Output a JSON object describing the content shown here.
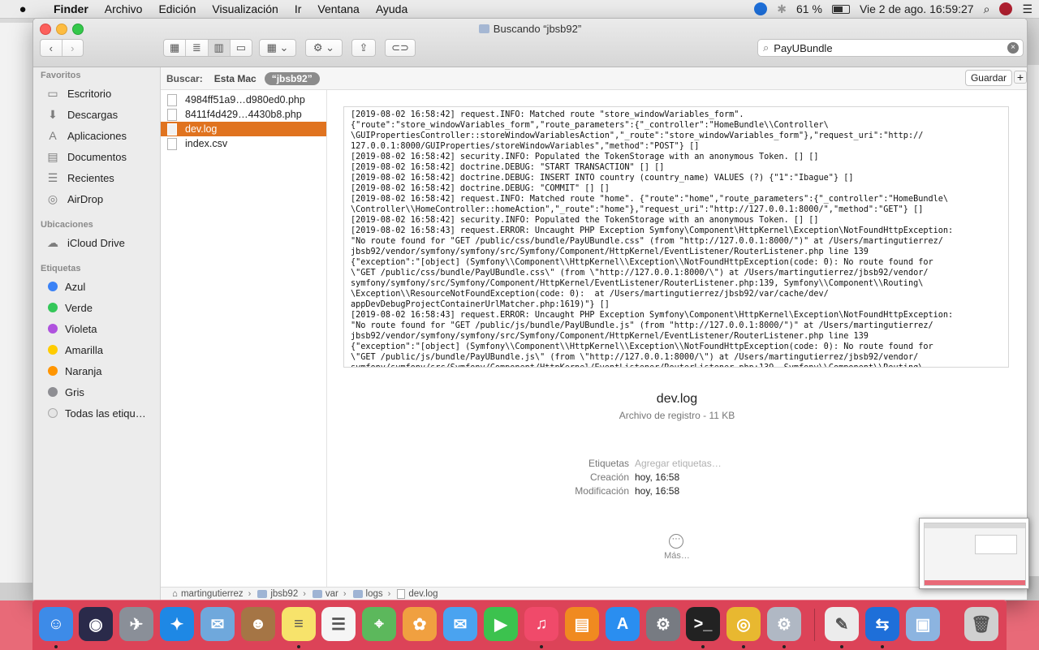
{
  "menubar": {
    "app": "Finder",
    "items": [
      "Archivo",
      "Edición",
      "Visualización",
      "Ir",
      "Ventana",
      "Ayuda"
    ],
    "battery": "61 %",
    "datetime": "Vie 2 de ago.  16:59:27"
  },
  "window": {
    "title": "Buscando “jbsb92”"
  },
  "search": {
    "value": "PayUBundle"
  },
  "scope": {
    "label": "Buscar:",
    "this_mac": "Esta Mac",
    "folder": "“jbsb92”",
    "save": "Guardar",
    "add": "+"
  },
  "sidebar": {
    "favorites_header": "Favoritos",
    "favorites": [
      {
        "label": "Escritorio",
        "icon": "desktop-icon"
      },
      {
        "label": "Descargas",
        "icon": "downloads-icon"
      },
      {
        "label": "Aplicaciones",
        "icon": "applications-icon"
      },
      {
        "label": "Documentos",
        "icon": "documents-icon"
      },
      {
        "label": "Recientes",
        "icon": "recents-icon"
      },
      {
        "label": "AirDrop",
        "icon": "airdrop-icon"
      }
    ],
    "locations_header": "Ubicaciones",
    "locations": [
      {
        "label": "iCloud Drive",
        "icon": "cloud-icon"
      }
    ],
    "tags_header": "Etiquetas",
    "tags": [
      {
        "label": "Azul",
        "color": "#3b82f6"
      },
      {
        "label": "Verde",
        "color": "#34c759"
      },
      {
        "label": "Violeta",
        "color": "#af52de"
      },
      {
        "label": "Amarilla",
        "color": "#ffcc00"
      },
      {
        "label": "Naranja",
        "color": "#ff9500"
      },
      {
        "label": "Gris",
        "color": "#8e8e93"
      },
      {
        "label": "Todas las etiqu…",
        "color": "#e5e5e5"
      }
    ]
  },
  "files": [
    {
      "name": "4984ff51a9…d980ed0.php",
      "selected": false
    },
    {
      "name": "8411f4d429…4430b8.php",
      "selected": false
    },
    {
      "name": "dev.log",
      "selected": true
    },
    {
      "name": "index.csv",
      "selected": false
    }
  ],
  "preview": {
    "log": "[2019-08-02 16:58:42] request.INFO: Matched route \"store_windowVariables_form\".\n{\"route\":\"store_windowVariables_form\",\"route_parameters\":{\"_controller\":\"HomeBundle\\\\Controller\\\n\\GUIPropertiesController::storeWindowVariablesAction\",\"_route\":\"store_windowVariables_form\"},\"request_uri\":\"http://\n127.0.0.1:8000/GUIProperties/storeWindowVariables\",\"method\":\"POST\"} []\n[2019-08-02 16:58:42] security.INFO: Populated the TokenStorage with an anonymous Token. [] []\n[2019-08-02 16:58:42] doctrine.DEBUG: \"START TRANSACTION\" [] []\n[2019-08-02 16:58:42] doctrine.DEBUG: INSERT INTO country (country_name) VALUES (?) {\"1\":\"Ibague\"} []\n[2019-08-02 16:58:42] doctrine.DEBUG: \"COMMIT\" [] []\n[2019-08-02 16:58:42] request.INFO: Matched route \"home\". {\"route\":\"home\",\"route_parameters\":{\"_controller\":\"HomeBundle\\\n\\Controller\\\\HomeController::homeAction\",\"_route\":\"home\"},\"request_uri\":\"http://127.0.0.1:8000/\",\"method\":\"GET\"} []\n[2019-08-02 16:58:42] security.INFO: Populated the TokenStorage with an anonymous Token. [] []\n[2019-08-02 16:58:43] request.ERROR: Uncaught PHP Exception Symfony\\Component\\HttpKernel\\Exception\\NotFoundHttpException:\n\"No route found for \"GET /public/css/bundle/PayUBundle.css\" (from \"http://127.0.0.1:8000/\")\" at /Users/martingutierrez/\njbsb92/vendor/symfony/symfony/src/Symfony/Component/HttpKernel/EventListener/RouterListener.php line 139\n{\"exception\":\"[object] (Symfony\\\\Component\\\\HttpKernel\\\\Exception\\\\NotFoundHttpException(code: 0): No route found for\n\\\"GET /public/css/bundle/PayUBundle.css\\\" (from \\\"http://127.0.0.1:8000/\\\") at /Users/martingutierrez/jbsb92/vendor/\nsymfony/symfony/src/Symfony/Component/HttpKernel/EventListener/RouterListener.php:139, Symfony\\\\Component\\\\Routing\\\n\\Exception\\\\ResourceNotFoundException(code: 0):  at /Users/martingutierrez/jbsb92/var/cache/dev/\nappDevDebugProjectContainerUrlMatcher.php:1619)\"} []\n[2019-08-02 16:58:43] request.ERROR: Uncaught PHP Exception Symfony\\Component\\HttpKernel\\Exception\\NotFoundHttpException:\n\"No route found for \"GET /public/js/bundle/PayUBundle.js\" (from \"http://127.0.0.1:8000/\")\" at /Users/martingutierrez/\njbsb92/vendor/symfony/symfony/src/Symfony/Component/HttpKernel/EventListener/RouterListener.php line 139\n{\"exception\":\"[object] (Symfony\\\\Component\\\\HttpKernel\\\\Exception\\\\NotFoundHttpException(code: 0): No route found for\n\\\"GET /public/js/bundle/PayUBundle.js\\\" (from \\\"http://127.0.0.1:8000/\\\") at /Users/martingutierrez/jbsb92/vendor/\nsymfony/symfony/src/Symfony/Component/HttpKernel/EventListener/RouterListener.php:139, Symfony\\\\Component\\\\Routing\\",
    "name": "dev.log",
    "kind": "Archivo de registro - 11 KB",
    "tags_label": "Etiquetas",
    "tags_placeholder": "Agregar etiquetas…",
    "created_label": "Creación",
    "created_value": "hoy, 16:58",
    "modified_label": "Modificación",
    "modified_value": "hoy, 16:58",
    "more_label": "Más…"
  },
  "pathbar": [
    "martingutierrez",
    "jbsb92",
    "var",
    "logs",
    "dev.log"
  ],
  "dock": [
    {
      "name": "finder-icon",
      "color": "#3d8be8",
      "glyph": "☺",
      "running": true
    },
    {
      "name": "siri-icon",
      "color": "#2a2a4a",
      "glyph": "◉",
      "running": false
    },
    {
      "name": "launchpad-icon",
      "color": "#8a8f98",
      "glyph": "✈",
      "running": false
    },
    {
      "name": "safari-icon",
      "color": "#1e88e5",
      "glyph": "✦",
      "running": false
    },
    {
      "name": "mail-icon",
      "color": "#6fa8dc",
      "glyph": "✉",
      "running": false
    },
    {
      "name": "contacts-icon",
      "color": "#a57545",
      "glyph": "☻",
      "running": false
    },
    {
      "name": "notes-icon",
      "color": "#f7e36b",
      "glyph": "≡",
      "running": true
    },
    {
      "name": "reminders-icon",
      "color": "#f5f5f5",
      "glyph": "☰",
      "running": false
    },
    {
      "name": "maps-icon",
      "color": "#5cb85c",
      "glyph": "⌖",
      "running": false
    },
    {
      "name": "photos-icon",
      "color": "#f0a040",
      "glyph": "✿",
      "running": false
    },
    {
      "name": "messages-icon",
      "color": "#4aa3f0",
      "glyph": "✉",
      "running": false
    },
    {
      "name": "facetime-icon",
      "color": "#3cc24e",
      "glyph": "▶",
      "running": false
    },
    {
      "name": "music-icon",
      "color": "#f04a6a",
      "glyph": "♫",
      "running": true
    },
    {
      "name": "books-icon",
      "color": "#f08a20",
      "glyph": "▤",
      "running": false
    },
    {
      "name": "app-store-icon",
      "color": "#2a8ef0",
      "glyph": "A",
      "running": false
    },
    {
      "name": "system-preferences-icon",
      "color": "#777b82",
      "glyph": "⚙",
      "running": false
    },
    {
      "name": "terminal-icon",
      "color": "#222222",
      "glyph": ">_",
      "running": true
    },
    {
      "name": "chrome-icon",
      "color": "#e8b830",
      "glyph": "◎",
      "running": true
    },
    {
      "name": "settings-utility-icon",
      "color": "#b0b8c4",
      "glyph": "⚙",
      "running": true
    },
    {
      "name": "textedit-icon",
      "color": "#ececec",
      "glyph": "✎",
      "running": true
    },
    {
      "name": "teamviewer-icon",
      "color": "#1e6fd9",
      "glyph": "⇆",
      "running": true
    },
    {
      "name": "simulator-icon",
      "color": "#8cb4e0",
      "glyph": "▣",
      "running": false
    },
    {
      "name": "trash-icon",
      "color": "#d0d0d0",
      "glyph": "🗑",
      "running": false
    }
  ]
}
